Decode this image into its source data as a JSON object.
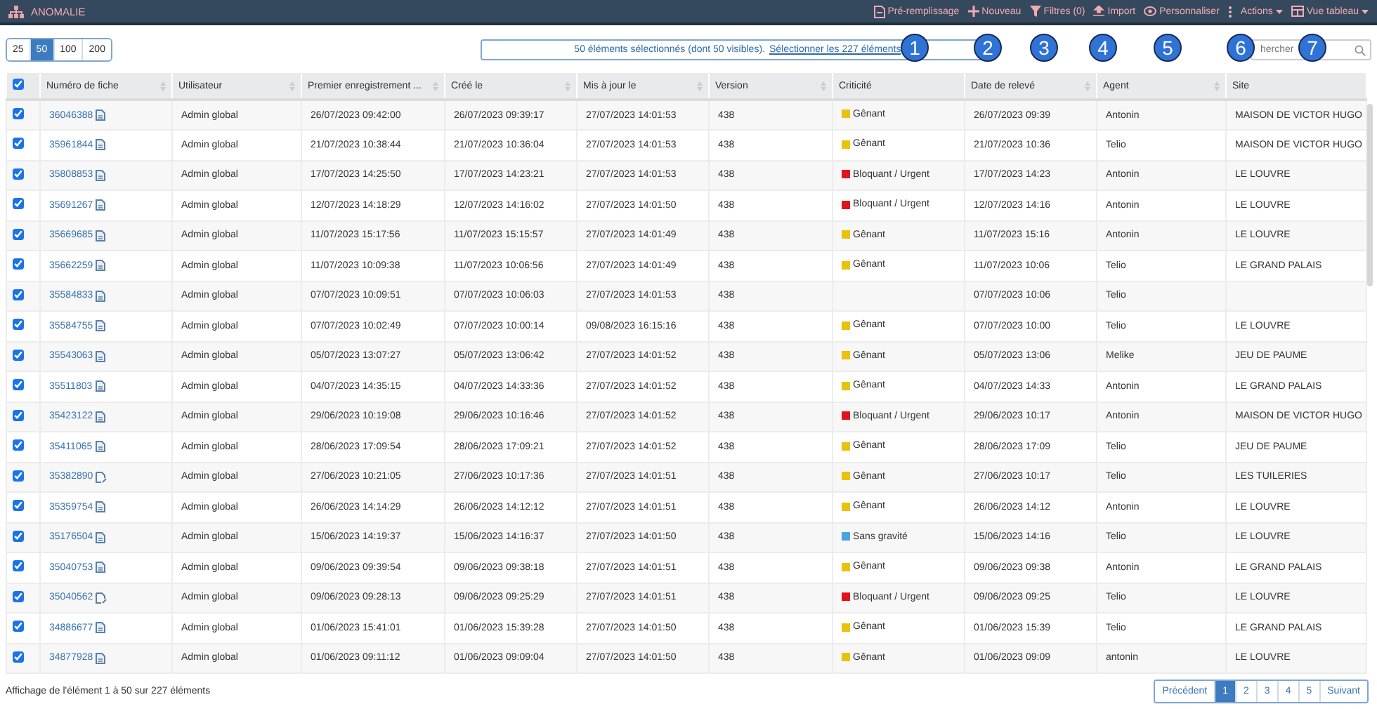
{
  "app_bar": {
    "title": "ANOMALIE",
    "actions": [
      {
        "label": "Pré-remplissage",
        "dropdown": false
      },
      {
        "label": "Nouveau",
        "dropdown": false
      },
      {
        "label": "Filtres (0)",
        "dropdown": false
      },
      {
        "label": "Import",
        "dropdown": false
      },
      {
        "label": "Personnaliser",
        "dropdown": false
      },
      {
        "label": "Actions",
        "dropdown": true
      },
      {
        "label": "Vue tableau",
        "dropdown": true
      }
    ]
  },
  "page_sizes": [
    {
      "label": "25",
      "selected": false
    },
    {
      "label": "50",
      "selected": true
    },
    {
      "label": "100",
      "selected": false
    },
    {
      "label": "200",
      "selected": false
    }
  ],
  "selection_banner": {
    "text": "50 éléments sélectionnés (dont 50 visibles).",
    "link": "Sélectionner les 227 éléments"
  },
  "search": {
    "placeholder": "hercher"
  },
  "callouts": [
    "1",
    "2",
    "3",
    "4",
    "5",
    "6",
    "7"
  ],
  "table": {
    "select_all_checked": true,
    "columns": [
      {
        "label": "Numéro de fiche",
        "sortable": true
      },
      {
        "label": "Utilisateur",
        "sortable": true
      },
      {
        "label": "Premier enregistrement ...",
        "sortable": true
      },
      {
        "label": "Créé le",
        "sortable": true
      },
      {
        "label": "Mis à jour le",
        "sortable": true
      },
      {
        "label": "Version",
        "sortable": true
      },
      {
        "label": "Criticité",
        "sortable": false
      },
      {
        "label": "Date de relevé",
        "sortable": true
      },
      {
        "label": "Agent",
        "sortable": true
      },
      {
        "label": "Site",
        "sortable": false
      }
    ],
    "rows": [
      {
        "checked": true,
        "number": "36046388",
        "edited": false,
        "user": "Admin global",
        "first": "26/07/2023 09:42:00",
        "created": "26/07/2023 09:39:17",
        "updated": "27/07/2023 14:01:53",
        "version": "438",
        "criticality": {
          "label": "Gênant",
          "color": "#e8c20c"
        },
        "date": "26/07/2023 09:39",
        "agent": "Antonin",
        "site": "MAISON DE VICTOR HUGO"
      },
      {
        "checked": true,
        "number": "35961844",
        "edited": false,
        "user": "Admin global",
        "first": "21/07/2023 10:38:44",
        "created": "21/07/2023 10:36:04",
        "updated": "27/07/2023 14:01:53",
        "version": "438",
        "criticality": {
          "label": "Gênant",
          "color": "#e8c20c"
        },
        "date": "21/07/2023 10:36",
        "agent": "Telio",
        "site": "MAISON DE VICTOR HUGO"
      },
      {
        "checked": true,
        "number": "35808853",
        "edited": false,
        "user": "Admin global",
        "first": "17/07/2023 14:25:50",
        "created": "17/07/2023 14:23:21",
        "updated": "27/07/2023 14:01:53",
        "version": "438",
        "criticality": {
          "label": "Bloquant / Urgent",
          "color": "#e0151b"
        },
        "date": "17/07/2023 14:23",
        "agent": "Antonin",
        "site": "LE LOUVRE"
      },
      {
        "checked": true,
        "number": "35691267",
        "edited": false,
        "user": "Admin global",
        "first": "12/07/2023 14:18:29",
        "created": "12/07/2023 14:16:02",
        "updated": "27/07/2023 14:01:50",
        "version": "438",
        "criticality": {
          "label": "Bloquant / Urgent",
          "color": "#e0151b"
        },
        "date": "12/07/2023 14:16",
        "agent": "Antonin",
        "site": "LE LOUVRE"
      },
      {
        "checked": true,
        "number": "35669685",
        "edited": false,
        "user": "Admin global",
        "first": "11/07/2023 15:17:56",
        "created": "11/07/2023 15:15:57",
        "updated": "27/07/2023 14:01:49",
        "version": "438",
        "criticality": {
          "label": "Gênant",
          "color": "#e8c20c"
        },
        "date": "11/07/2023 15:16",
        "agent": "Antonin",
        "site": "LE LOUVRE"
      },
      {
        "checked": true,
        "number": "35662259",
        "edited": false,
        "user": "Admin global",
        "first": "11/07/2023 10:09:38",
        "created": "11/07/2023 10:06:56",
        "updated": "27/07/2023 14:01:49",
        "version": "438",
        "criticality": {
          "label": "Gênant",
          "color": "#e8c20c"
        },
        "date": "11/07/2023 10:06",
        "agent": "Telio",
        "site": "LE GRAND PALAIS"
      },
      {
        "checked": true,
        "number": "35584833",
        "edited": false,
        "user": "Admin global",
        "first": "07/07/2023 10:09:51",
        "created": "07/07/2023 10:06:03",
        "updated": "27/07/2023 14:01:53",
        "version": "438",
        "date": "07/07/2023 10:06",
        "agent": "Telio"
      },
      {
        "checked": true,
        "number": "35584755",
        "edited": false,
        "user": "Admin global",
        "first": "07/07/2023 10:02:49",
        "created": "07/07/2023 10:00:14",
        "updated": "09/08/2023 16:15:16",
        "version": "438",
        "criticality": {
          "label": "Gênant",
          "color": "#e8c20c"
        },
        "date": "07/07/2023 10:00",
        "agent": "Telio",
        "site": "LE LOUVRE"
      },
      {
        "checked": true,
        "number": "35543063",
        "edited": false,
        "user": "Admin global",
        "first": "05/07/2023 13:07:27",
        "created": "05/07/2023 13:06:42",
        "updated": "27/07/2023 14:01:52",
        "version": "438",
        "criticality": {
          "label": "Gênant",
          "color": "#e8c20c"
        },
        "date": "05/07/2023 13:06",
        "agent": "Melike",
        "site": "JEU DE PAUME"
      },
      {
        "checked": true,
        "number": "35511803",
        "edited": false,
        "user": "Admin global",
        "first": "04/07/2023 14:35:15",
        "created": "04/07/2023 14:33:36",
        "updated": "27/07/2023 14:01:52",
        "version": "438",
        "criticality": {
          "label": "Gênant",
          "color": "#e8c20c"
        },
        "date": "04/07/2023 14:33",
        "agent": "Antonin",
        "site": "LE GRAND PALAIS"
      },
      {
        "checked": true,
        "number": "35423122",
        "edited": false,
        "user": "Admin global",
        "first": "29/06/2023 10:19:08",
        "created": "29/06/2023 10:16:46",
        "updated": "27/07/2023 14:01:52",
        "version": "438",
        "criticality": {
          "label": "Bloquant / Urgent",
          "color": "#e0151b"
        },
        "date": "29/06/2023 10:17",
        "agent": "Antonin",
        "site": "MAISON DE VICTOR HUGO"
      },
      {
        "checked": true,
        "number": "35411065",
        "edited": false,
        "user": "Admin global",
        "first": "28/06/2023 17:09:54",
        "created": "28/06/2023 17:09:21",
        "updated": "27/07/2023 14:01:52",
        "version": "438",
        "criticality": {
          "label": "Gênant",
          "color": "#e8c20c"
        },
        "date": "28/06/2023 17:09",
        "agent": "Telio",
        "site": "JEU DE PAUME"
      },
      {
        "checked": true,
        "number": "35382890",
        "edited": true,
        "user": "Admin global",
        "first": "27/06/2023 10:21:05",
        "created": "27/06/2023 10:17:36",
        "updated": "27/07/2023 14:01:51",
        "version": "438",
        "criticality": {
          "label": "Gênant",
          "color": "#e8c20c"
        },
        "date": "27/06/2023 10:17",
        "agent": "Telio",
        "site": "LES TUILERIES"
      },
      {
        "checked": true,
        "number": "35359754",
        "edited": false,
        "user": "Admin global",
        "first": "26/06/2023 14:14:29",
        "created": "26/06/2023 14:12:12",
        "updated": "27/07/2023 14:01:51",
        "version": "438",
        "criticality": {
          "label": "Gênant",
          "color": "#e8c20c"
        },
        "date": "26/06/2023 14:12",
        "agent": "Antonin",
        "site": "LE LOUVRE"
      },
      {
        "checked": true,
        "number": "35176504",
        "edited": false,
        "user": "Admin global",
        "first": "15/06/2023 14:19:37",
        "created": "15/06/2023 14:16:37",
        "updated": "27/07/2023 14:01:50",
        "version": "438",
        "criticality": {
          "label": "Sans gravité",
          "color": "#4aa3df"
        },
        "date": "15/06/2023 14:16",
        "agent": "Telio",
        "site": "LE LOUVRE"
      },
      {
        "checked": true,
        "number": "35040753",
        "edited": false,
        "user": "Admin global",
        "first": "09/06/2023 09:39:54",
        "created": "09/06/2023 09:38:18",
        "updated": "27/07/2023 14:01:51",
        "version": "438",
        "criticality": {
          "label": "Gênant",
          "color": "#e8c20c"
        },
        "date": "09/06/2023 09:38",
        "agent": "Antonin",
        "site": "LE GRAND PALAIS"
      },
      {
        "checked": true,
        "number": "35040562",
        "edited": true,
        "user": "Admin global",
        "first": "09/06/2023 09:28:13",
        "created": "09/06/2023 09:25:29",
        "updated": "27/07/2023 14:01:51",
        "version": "438",
        "criticality": {
          "label": "Bloquant / Urgent",
          "color": "#e0151b"
        },
        "date": "09/06/2023 09:25",
        "agent": "Telio",
        "site": "LE LOUVRE"
      },
      {
        "checked": true,
        "number": "34886677",
        "edited": false,
        "user": "Admin global",
        "first": "01/06/2023 15:41:01",
        "created": "01/06/2023 15:39:28",
        "updated": "27/07/2023 14:01:50",
        "version": "438",
        "criticality": {
          "label": "Gênant",
          "color": "#e8c20c"
        },
        "date": "01/06/2023 15:39",
        "agent": "Telio",
        "site": "LE GRAND PALAIS"
      },
      {
        "checked": true,
        "number": "34877928",
        "edited": false,
        "user": "Admin global",
        "first": "01/06/2023 09:11:12",
        "created": "01/06/2023 09:09:04",
        "updated": "27/07/2023 14:01:50",
        "version": "438",
        "criticality": {
          "label": "Gênant",
          "color": "#e8c20c"
        },
        "date": "01/06/2023 09:09",
        "agent": "antonin",
        "site": "LE LOUVRE"
      }
    ]
  },
  "footer": {
    "summary": "Affichage de l'élément 1 à 50 sur 227 éléments",
    "previous": "Précédent",
    "pages": [
      {
        "label": "1",
        "selected": true
      },
      {
        "label": "2",
        "selected": false
      },
      {
        "label": "3",
        "selected": false
      },
      {
        "label": "4",
        "selected": false
      },
      {
        "label": "5",
        "selected": false
      }
    ],
    "next": "Suivant"
  }
}
